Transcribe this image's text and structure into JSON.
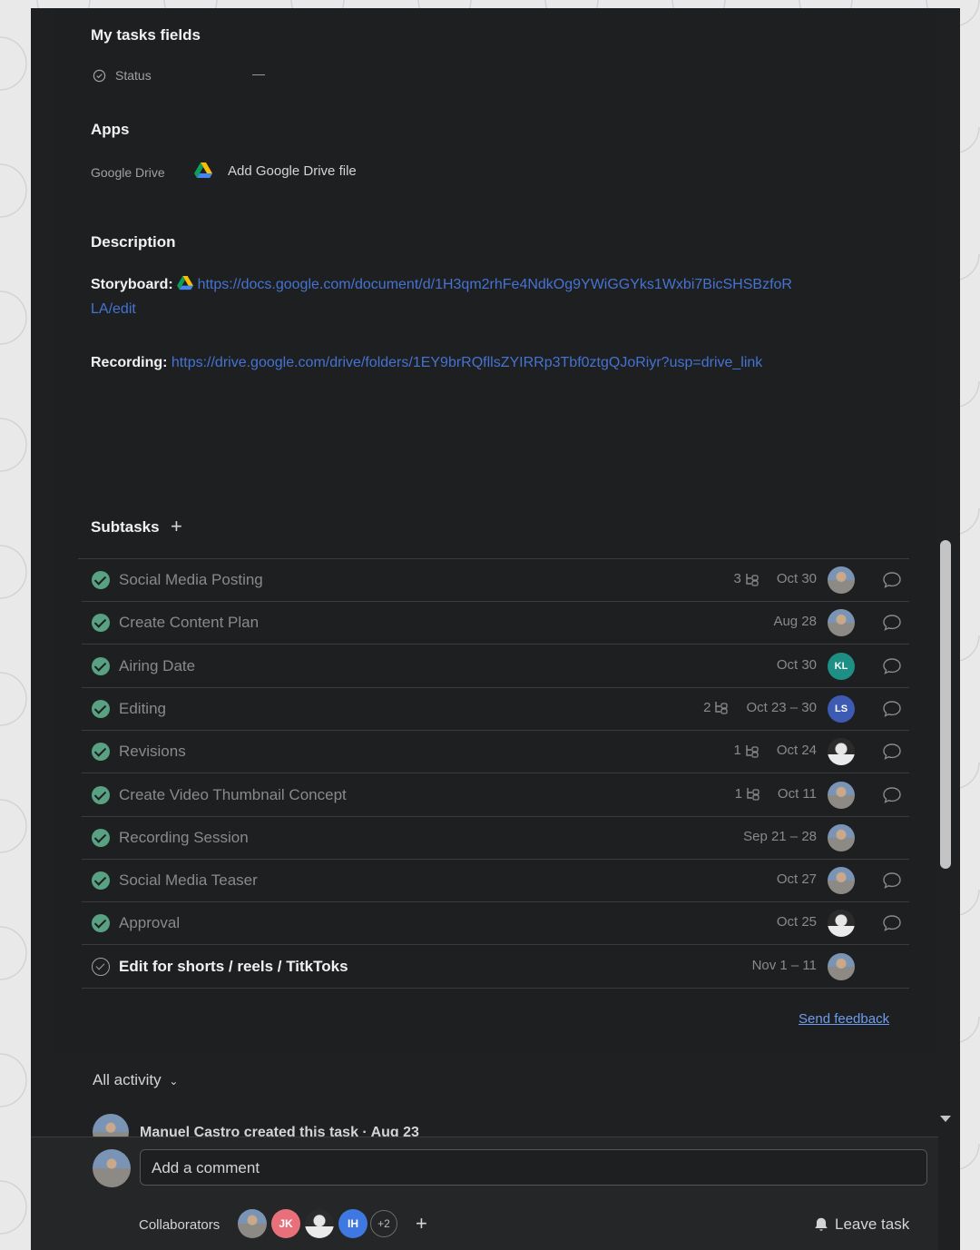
{
  "my_tasks_fields": {
    "title": "My tasks fields",
    "status_label": "Status",
    "status_value": "—"
  },
  "apps": {
    "title": "Apps",
    "gdrive_label": "Google Drive",
    "gdrive_action": "Add Google Drive file"
  },
  "description": {
    "title": "Description",
    "storyboard_label": "Storyboard:",
    "storyboard_url_line1": "https://docs.google.com/document/d/1H3qm2rhFe4NdkOg9YWiGGYks1Wxbi7BicSHSBzfoR",
    "storyboard_url_line2": "LA/edit",
    "recording_label": "Recording:",
    "recording_url": "https://drive.google.com/drive/folders/1EY9brRQfllsZYIRRp3Tbf0ztgQJoRiyr?usp=drive_link"
  },
  "subtasks": {
    "title": "Subtasks",
    "items": [
      {
        "name": "Social Media Posting",
        "subcount": "3",
        "date": "Oct 30",
        "avatar": "photo",
        "avatar_text": "",
        "done": true,
        "comment": true
      },
      {
        "name": "Create Content Plan",
        "subcount": "",
        "date": "Aug 28",
        "avatar": "photo",
        "avatar_text": "",
        "done": true,
        "comment": true
      },
      {
        "name": "Airing Date",
        "subcount": "",
        "date": "Oct 30",
        "avatar": "initials",
        "avatar_text": "KL",
        "avatar_color": "#1e8f84",
        "done": true,
        "comment": true
      },
      {
        "name": "Editing",
        "subcount": "2",
        "date": "Oct 23 – 30",
        "avatar": "initials",
        "avatar_text": "LS",
        "avatar_color": "#3d5bb3",
        "done": true,
        "comment": true
      },
      {
        "name": "Revisions",
        "subcount": "1",
        "date": "Oct 24",
        "avatar": "dark",
        "avatar_text": "",
        "done": true,
        "comment": true
      },
      {
        "name": "Create Video Thumbnail Concept",
        "subcount": "1",
        "date": "Oct 11",
        "avatar": "photo",
        "avatar_text": "",
        "done": true,
        "comment": true
      },
      {
        "name": "Recording Session",
        "subcount": "",
        "date": "Sep 21 – 28",
        "avatar": "photo",
        "avatar_text": "",
        "done": true,
        "comment": false
      },
      {
        "name": "Social Media Teaser",
        "subcount": "",
        "date": "Oct 27",
        "avatar": "photo",
        "avatar_text": "",
        "done": true,
        "comment": true
      },
      {
        "name": "Approval",
        "subcount": "",
        "date": "Oct 25",
        "avatar": "dark",
        "avatar_text": "",
        "done": true,
        "comment": true
      },
      {
        "name": "Edit for shorts / reels / TitkToks",
        "subcount": "",
        "date": "Nov 1 – 11",
        "avatar": "photo",
        "avatar_text": "",
        "done": false,
        "comment": false
      }
    ],
    "send_feedback": "Send feedback"
  },
  "activity": {
    "filter_label": "All activity",
    "first_entry": "Manuel Castro created this task · Aug 23"
  },
  "comment_box": {
    "placeholder": "Add a comment"
  },
  "footer": {
    "collaborators_label": "Collaborators",
    "collaborators": [
      {
        "type": "photo",
        "text": ""
      },
      {
        "type": "initials",
        "text": "JK",
        "color": "#e8707a"
      },
      {
        "type": "dark",
        "text": ""
      },
      {
        "type": "initials",
        "text": "IH",
        "color": "#3f78e0"
      }
    ],
    "more_count": "+2",
    "leave_task": "Leave task"
  },
  "colors": {
    "accent_link": "#4573d2",
    "complete_green": "#58a182",
    "panel_bg": "#1e1f21"
  }
}
